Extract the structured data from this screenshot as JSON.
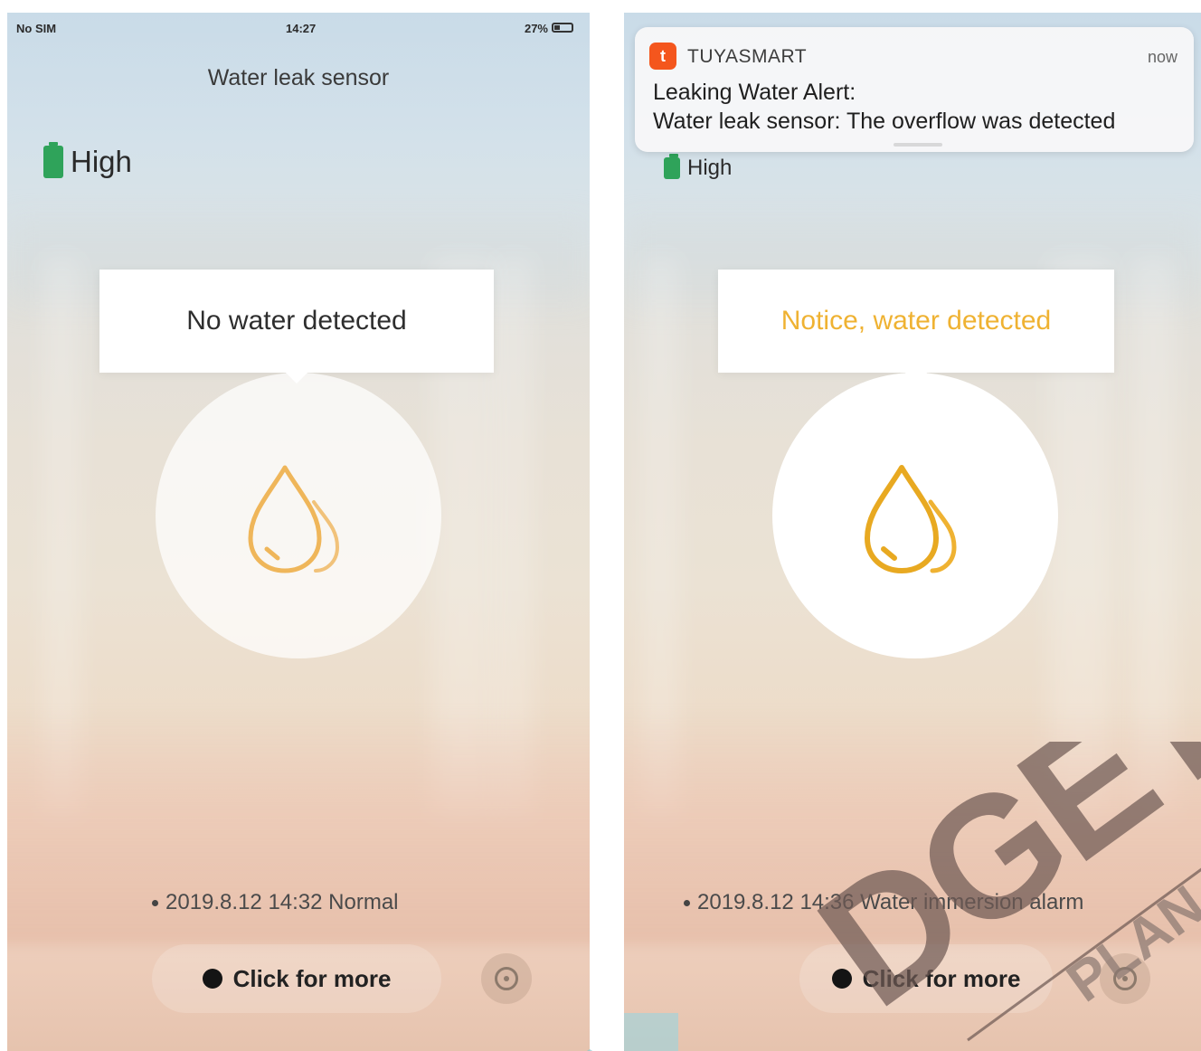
{
  "left_screen": {
    "status_bar": {
      "carrier": "No SIM",
      "time": "14:27",
      "battery": "27%"
    },
    "title": "Water leak sensor",
    "battery_level": "High",
    "status_message": "No water detected",
    "status_icon": "water-drops-icon",
    "latest_record": "2019.8.12 14:32 Normal",
    "more_button": "Click for more",
    "settings_icon": "settings-icon"
  },
  "right_screen": {
    "battery_level": "High",
    "status_message": "Notice, water detected",
    "status_icon": "water-drops-icon",
    "latest_record": "2019.8.12 14:36 Water immersion alarm",
    "more_button": "Click for more",
    "settings_icon": "settings-icon"
  },
  "notification": {
    "app_name": "TUYASMART",
    "time": "now",
    "headline": "Leaking Water Alert:",
    "message": "Water leak sensor: The overflow was detected",
    "app_icon_glyph": "t"
  },
  "colors": {
    "accent_orange": "#efb232",
    "battery_green": "#2fa35a",
    "notification_icon": "#f4561d"
  }
}
